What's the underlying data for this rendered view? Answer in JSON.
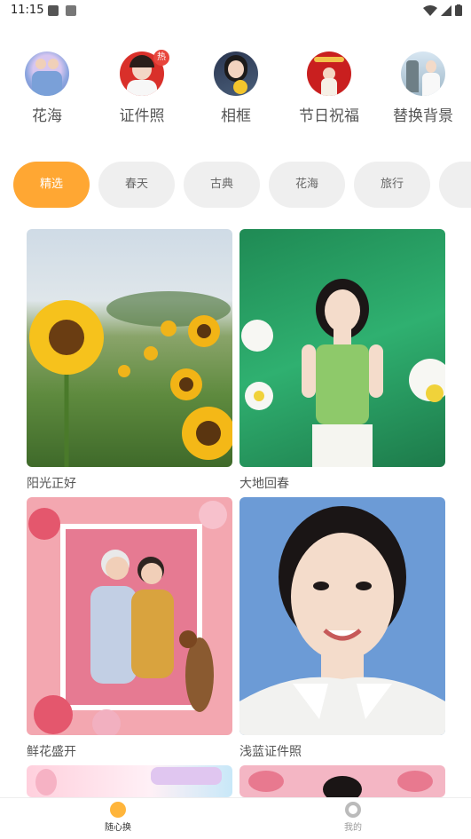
{
  "status_bar": {
    "time": "11:15"
  },
  "categories": [
    {
      "label": "花海",
      "hot": false
    },
    {
      "label": "证件照",
      "hot": true,
      "badge": "热"
    },
    {
      "label": "相框",
      "hot": false
    },
    {
      "label": "节日祝福",
      "hot": false
    },
    {
      "label": "替换背景",
      "hot": false
    }
  ],
  "tabs": [
    {
      "label": "精选",
      "active": true
    },
    {
      "label": "春天",
      "active": false
    },
    {
      "label": "古典",
      "active": false
    },
    {
      "label": "花海",
      "active": false
    },
    {
      "label": "旅行",
      "active": false
    }
  ],
  "cards": [
    {
      "title": "阳光正好"
    },
    {
      "title": "大地回春"
    },
    {
      "title": "鲜花盛开"
    },
    {
      "title": "浅蓝证件照"
    }
  ],
  "bottom_nav": {
    "home_label": "随心换",
    "mine_label": "我的"
  },
  "colors": {
    "accent": "#ffa733",
    "badge": "#e8453c",
    "nav_active": "#333333",
    "nav_inactive": "#999999"
  }
}
